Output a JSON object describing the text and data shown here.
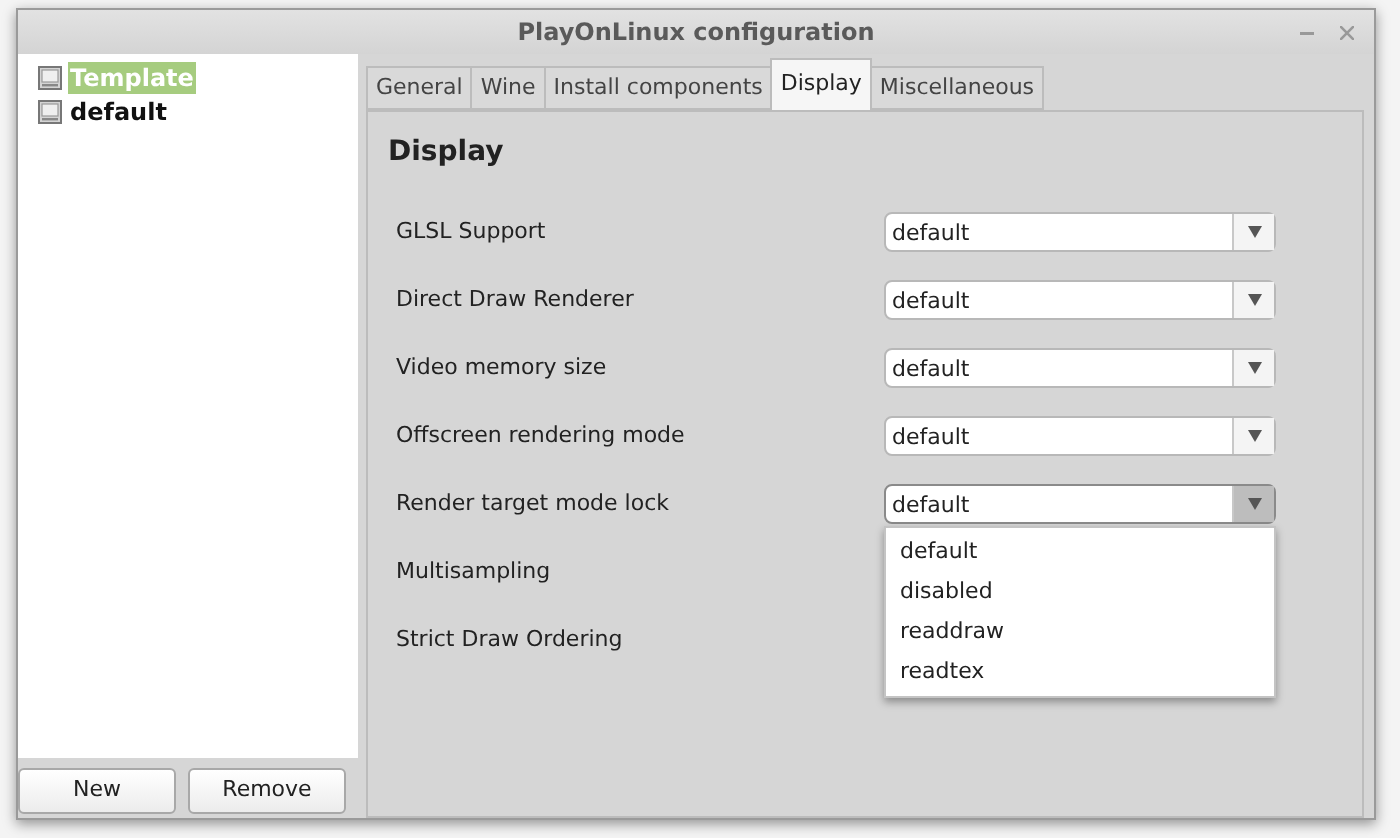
{
  "window": {
    "title": "PlayOnLinux configuration"
  },
  "sidebar": {
    "items": [
      {
        "label": "Template",
        "selected": true
      },
      {
        "label": "default",
        "selected": false
      }
    ]
  },
  "sidebar_buttons": [
    "New",
    "Remove"
  ],
  "tabs": [
    {
      "label": "General",
      "selected": false
    },
    {
      "label": "Wine",
      "selected": false
    },
    {
      "label": "Install components",
      "selected": false
    },
    {
      "label": "Display",
      "selected": true
    },
    {
      "label": "Miscellaneous",
      "selected": false
    }
  ],
  "panel": {
    "title": "Display",
    "settings": [
      {
        "label": "GLSL Support",
        "value": "default",
        "expanded": false
      },
      {
        "label": "Direct Draw Renderer",
        "value": "default",
        "expanded": false
      },
      {
        "label": "Video memory size",
        "value": "default",
        "expanded": false
      },
      {
        "label": "Offscreen rendering mode",
        "value": "default",
        "expanded": false
      },
      {
        "label": "Render target mode lock",
        "value": "default",
        "expanded": true,
        "options": [
          "default",
          "disabled",
          "readdraw",
          "readtex"
        ]
      },
      {
        "label": "Multisampling"
      },
      {
        "label": "Strict Draw Ordering"
      }
    ]
  }
}
